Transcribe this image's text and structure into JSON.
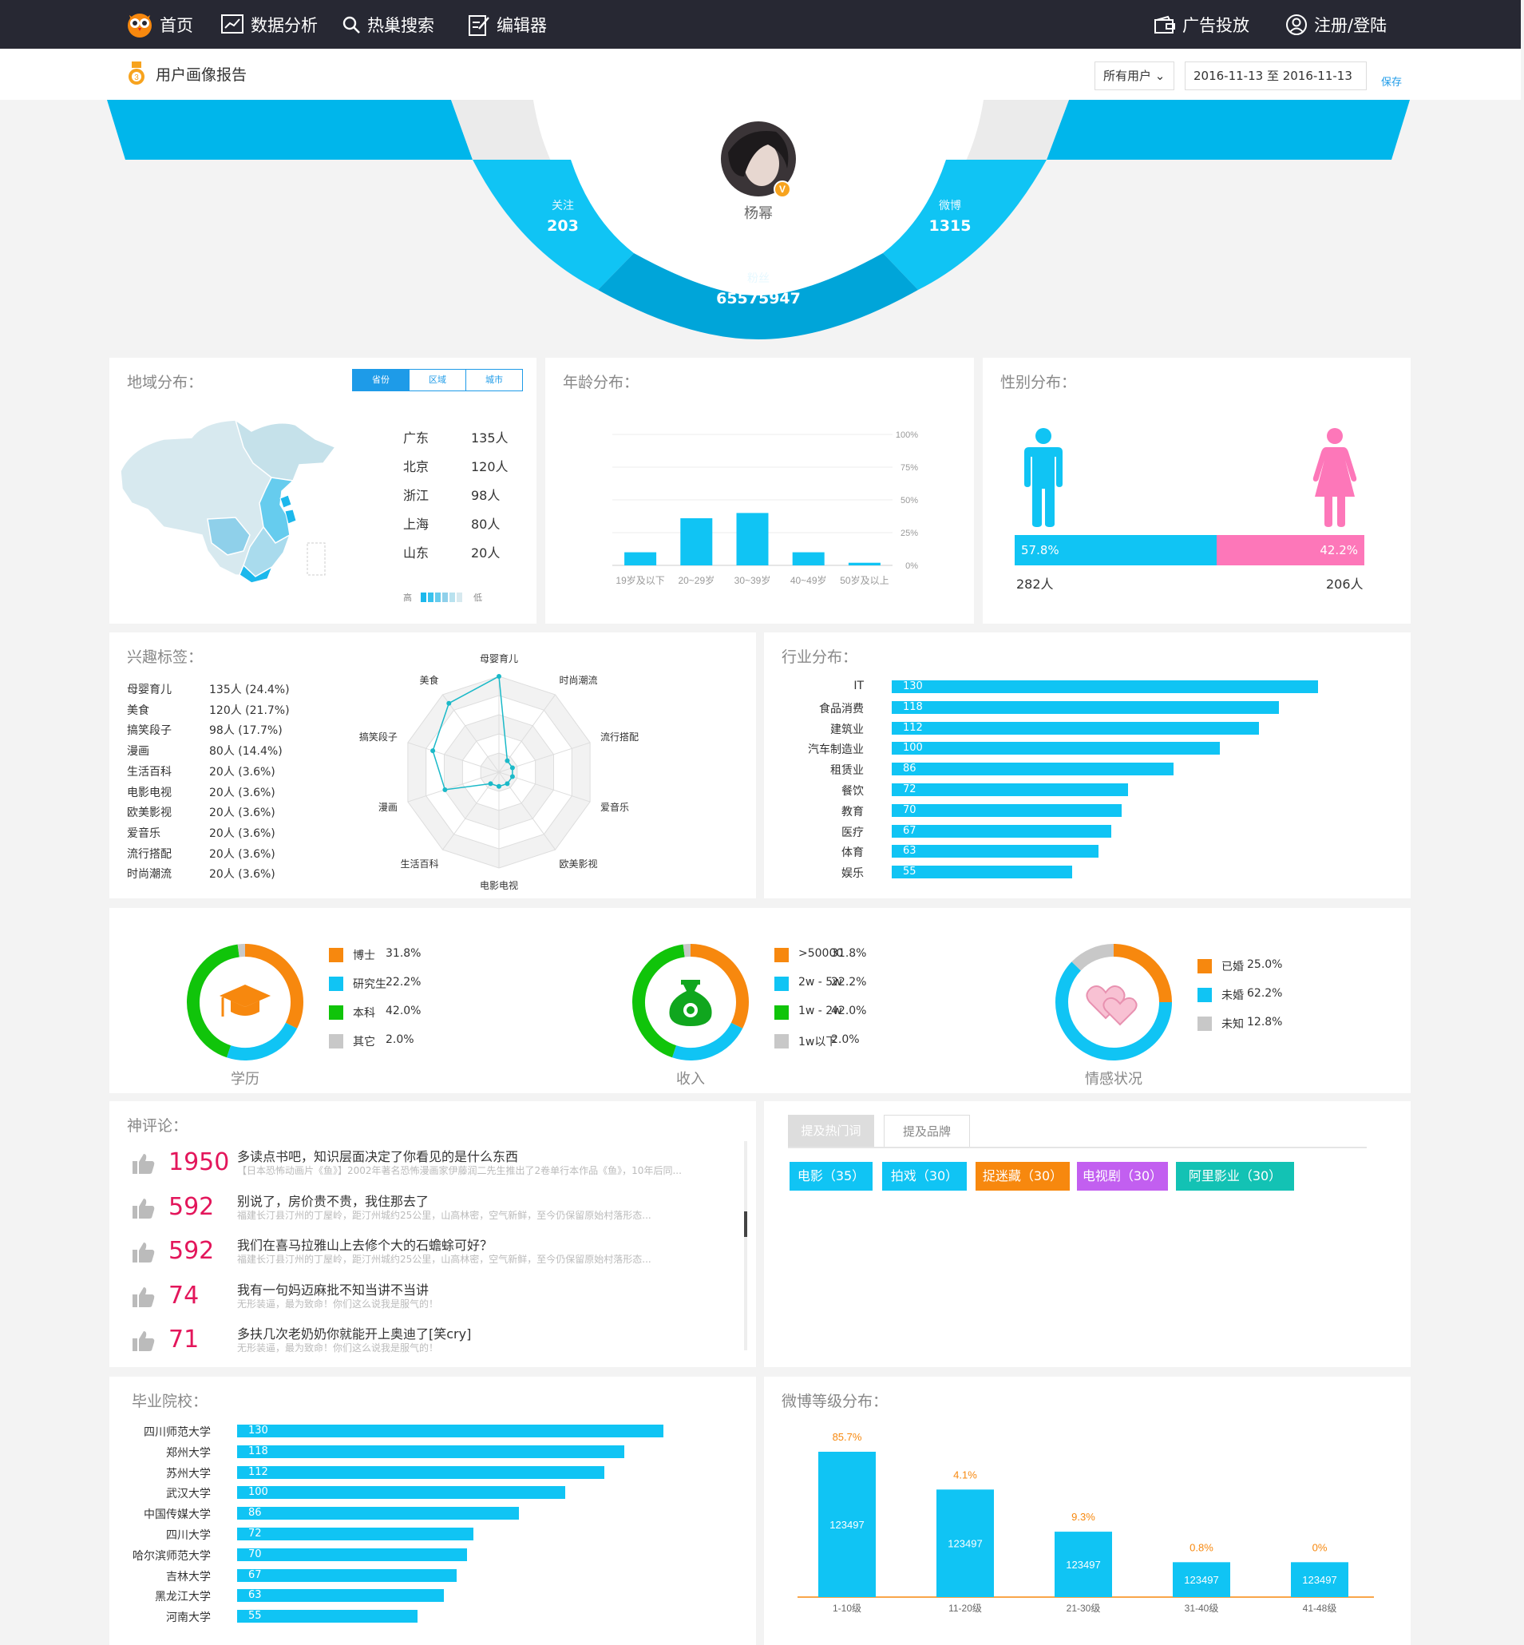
{
  "nav": {
    "home": "首页",
    "analysis": "数据分析",
    "hot_search": "热巢搜索",
    "editor": "编辑器",
    "ads": "广告投放",
    "login": "注册/登陆"
  },
  "subbar": {
    "title": "用户画像报告",
    "user_filter": "所有用户",
    "date_range": "2016-11-13 至 2016-11-13",
    "save": "保存"
  },
  "profile": {
    "name": "杨幂",
    "follow_label": "关注",
    "follow": "203",
    "weibo_label": "微博",
    "weibo": "1315",
    "fans_label": "粉丝",
    "fans": "65575947"
  },
  "region": {
    "title": "地域分布：",
    "tabs": [
      "省份",
      "区域",
      "城市"
    ],
    "rows": [
      {
        "name": "广东",
        "value": "135人"
      },
      {
        "name": "北京",
        "value": "120人"
      },
      {
        "name": "浙江",
        "value": "98人"
      },
      {
        "name": "上海",
        "value": "80人"
      },
      {
        "name": "山东",
        "value": "20人"
      }
    ],
    "legend_high": "高",
    "legend_low": "低"
  },
  "age": {
    "title": "年龄分布：",
    "chart_data": {
      "type": "bar",
      "categories": [
        "19岁及以下",
        "20~29岁",
        "30~39岁",
        "40~49岁",
        "50岁及以上"
      ],
      "values": [
        10,
        36,
        40,
        10,
        2
      ],
      "ylim": [
        0,
        100
      ],
      "yticks": [
        "100%",
        "75%",
        "50%",
        "25%",
        "0%"
      ]
    }
  },
  "gender": {
    "title": "性别分布：",
    "male_pct": "57.8%",
    "female_pct": "42.2%",
    "male_count": "282人",
    "female_count": "206人",
    "male_share": 57.8,
    "colors": {
      "male": "#10c4f4",
      "female": "#fd77b9"
    }
  },
  "interest": {
    "title": "兴趣标签：",
    "rows": [
      {
        "name": "母婴育儿",
        "value": "135人 (24.4%)"
      },
      {
        "name": "美食",
        "value": "120人 (21.7%)"
      },
      {
        "name": "搞笑段子",
        "value": "98人 (17.7%)"
      },
      {
        "name": "漫画",
        "value": "80人 (14.4%)"
      },
      {
        "name": "生活百科",
        "value": "20人 (3.6%)"
      },
      {
        "name": "电影电视",
        "value": "20人 (3.6%)"
      },
      {
        "name": "欧美影视",
        "value": "20人 (3.6%)"
      },
      {
        "name": "爱音乐",
        "value": "20人 (3.6%)"
      },
      {
        "name": "流行搭配",
        "value": "20人 (3.6%)"
      },
      {
        "name": "时尚潮流",
        "value": "20人 (3.6%)"
      }
    ],
    "radar": {
      "axes": [
        "母婴育儿",
        "时尚潮流",
        "流行搭配",
        "爱音乐",
        "欧美影视",
        "电影电视",
        "生活百科",
        "漫画",
        "搞笑段子",
        "美食"
      ],
      "values": [
        135,
        20,
        20,
        20,
        20,
        20,
        20,
        80,
        98,
        120
      ],
      "max": 135
    }
  },
  "industry": {
    "title": "行业分布：",
    "chart_data": {
      "type": "bar",
      "orientation": "horizontal",
      "categories": [
        "IT",
        "食品消费",
        "建筑业",
        "汽车制造业",
        "租赁业",
        "餐饮",
        "教育",
        "医疗",
        "体育",
        "娱乐"
      ],
      "values": [
        130,
        118,
        112,
        100,
        86,
        72,
        70,
        67,
        63,
        55
      ]
    }
  },
  "education": {
    "label": "学历",
    "items": [
      {
        "name": "博士",
        "pct": "31.8%",
        "value": 31.8,
        "color": "#f7880e"
      },
      {
        "name": "研究生",
        "pct": "22.2%",
        "value": 22.2,
        "color": "#10c4f4"
      },
      {
        "name": "本科",
        "pct": "42.0%",
        "value": 42.0,
        "color": "#10c40a"
      },
      {
        "name": "其它",
        "pct": "2.0%",
        "value": 2.0,
        "color": "#c8c8c8"
      }
    ]
  },
  "income": {
    "label": "收入",
    "items": [
      {
        "name": ">50000",
        "pct": "31.8%",
        "value": 31.8,
        "color": "#f7880e"
      },
      {
        "name": "2w - 5w",
        "pct": "22.2%",
        "value": 22.2,
        "color": "#10c4f4"
      },
      {
        "name": "1w - 2w",
        "pct": "42.0%",
        "value": 42.0,
        "color": "#10c40a"
      },
      {
        "name": "1w以下",
        "pct": "2.0%",
        "value": 2.0,
        "color": "#c8c8c8"
      }
    ]
  },
  "marriage": {
    "label": "情感状况",
    "items": [
      {
        "name": "已婚",
        "pct": "25.0%",
        "value": 25.0,
        "color": "#f7880e"
      },
      {
        "name": "未婚",
        "pct": "62.2%",
        "value": 62.2,
        "color": "#10c4f4"
      },
      {
        "name": "未知",
        "pct": "12.8%",
        "value": 12.8,
        "color": "#c8c8c8"
      }
    ]
  },
  "comments": {
    "title": "神评论：",
    "items": [
      {
        "likes": "1950",
        "text": "多读点书吧，知识层面决定了你看见的是什么东西",
        "sub": "【日本恐怖动画片《鱼》】2002年著名恐怖漫画家伊藤润二先生推出了2卷单行本作品《鱼》，10年后同..."
      },
      {
        "likes": "592",
        "text": "别说了，房价贵不贵，我住那去了",
        "sub": "福建长汀县汀州的丁屋岭，距汀州城约25公里，山高林密，空气新鲜，至今仍保留原始村落形态..."
      },
      {
        "likes": "592",
        "text": "我们在喜马拉雅山上去修个大的石蟾蜍可好？",
        "sub": "福建长汀县汀州的丁屋岭，距汀州城约25公里，山高林密，空气新鲜，至今仍保留原始村落形态..."
      },
      {
        "likes": "74",
        "text": "我有一句妈迈麻批不知当讲不当讲",
        "sub": "无形装逼，最为致命！你们这么说我是服气的！"
      },
      {
        "likes": "71",
        "text": "多扶几次老奶奶你就能开上奥迪了[笑cry]",
        "sub": "无形装逼，最为致命！你们这么说我是服气的！"
      }
    ]
  },
  "mentions": {
    "tabs": [
      "提及热门词",
      "提及品牌"
    ],
    "tags": [
      {
        "text": "电影（35）",
        "color": "#10c4f4"
      },
      {
        "text": "拍戏（30）",
        "color": "#10c4f4"
      },
      {
        "text": "捉迷藏（30）",
        "color": "#f7880e"
      },
      {
        "text": "电视剧（30）",
        "color": "#c25ff0"
      },
      {
        "text": "阿里影业（30）",
        "color": "#13c2b4"
      }
    ]
  },
  "schools": {
    "title": "毕业院校：",
    "chart_data": {
      "type": "bar",
      "orientation": "horizontal",
      "categories": [
        "四川师范大学",
        "郑州大学",
        "苏州大学",
        "武汉大学",
        "中国传媒大学",
        "四川大学",
        "哈尔滨师范大学",
        "吉林大学",
        "黑龙江大学",
        "河南大学"
      ],
      "values": [
        130,
        118,
        112,
        100,
        86,
        72,
        70,
        67,
        63,
        55
      ]
    }
  },
  "weibo_level": {
    "title": "微博等级分布：",
    "chart_data": {
      "type": "bar",
      "categories": [
        "1-10级",
        "11-20级",
        "21-30级",
        "31-40级",
        "41-48级"
      ],
      "pct": [
        "85.7%",
        "4.1%",
        "9.3%",
        "0.8%",
        "0%"
      ],
      "labels": [
        "123497",
        "123497",
        "123497",
        "123497",
        "123497"
      ],
      "heights": [
        100,
        74,
        45,
        24,
        24
      ]
    }
  },
  "colors": {
    "accent": "#10c4f4",
    "nav_bg": "#272833",
    "likes": "#e3165b"
  }
}
